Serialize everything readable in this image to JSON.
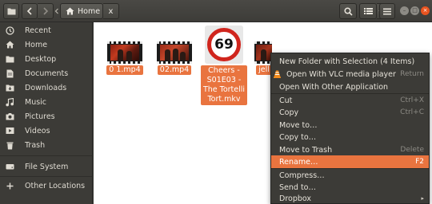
{
  "header": {
    "back_icon": "chevron-left-icon",
    "forward_icon": "chevron-right-icon",
    "path_home_label": "Home",
    "path_close_label": "x",
    "search_icon": "search-icon",
    "view_icon": "list-view-icon",
    "menu_icon": "hamburger-menu-icon"
  },
  "window_controls": {
    "minimize": "–",
    "maximize": "□",
    "close": "×"
  },
  "sidebar": {
    "items": [
      {
        "label": "Recent",
        "icon": "clock-icon"
      },
      {
        "label": "Home",
        "icon": "home-icon"
      },
      {
        "label": "Desktop",
        "icon": "folder-icon"
      },
      {
        "label": "Documents",
        "icon": "document-icon"
      },
      {
        "label": "Downloads",
        "icon": "download-icon"
      },
      {
        "label": "Music",
        "icon": "music-icon"
      },
      {
        "label": "Pictures",
        "icon": "camera-icon"
      },
      {
        "label": "Videos",
        "icon": "video-icon"
      },
      {
        "label": "Trash",
        "icon": "trash-icon"
      },
      {
        "label": "File System",
        "icon": "drive-icon"
      },
      {
        "label": "Other Locations",
        "icon": "plus-icon"
      }
    ]
  },
  "files": [
    {
      "name": "0 1.mp4"
    },
    {
      "name": "02.mp4"
    },
    {
      "name_lines": [
        "Cheers -",
        "S01E03 -",
        "The Tortelli",
        "Tort.mkv"
      ],
      "badge": "69"
    },
    {
      "name": "jell"
    }
  ],
  "context_menu": {
    "items": [
      {
        "label": "New Folder with Selection (4 Items)",
        "accel": ""
      },
      {
        "label": "Open With VLC media player",
        "accel": "Return",
        "icon": "vlc-cone-icon"
      },
      {
        "label": "Open With Other Application",
        "accel": ""
      },
      {
        "label": "Cut",
        "accel": "Ctrl+X"
      },
      {
        "label": "Copy",
        "accel": "Ctrl+C"
      },
      {
        "label": "Move to…",
        "accel": ""
      },
      {
        "label": "Copy to…",
        "accel": ""
      },
      {
        "label": "Move to Trash",
        "accel": "Delete"
      },
      {
        "label": "Rename…",
        "accel": "F2"
      },
      {
        "label": "Compress…",
        "accel": ""
      },
      {
        "label": "Send to…",
        "accel": ""
      },
      {
        "label": "Dropbox",
        "accel": "▸"
      }
    ]
  },
  "colors": {
    "accent": "#e9743f",
    "panel": "#3c3b37",
    "window_close": "#e95420"
  }
}
